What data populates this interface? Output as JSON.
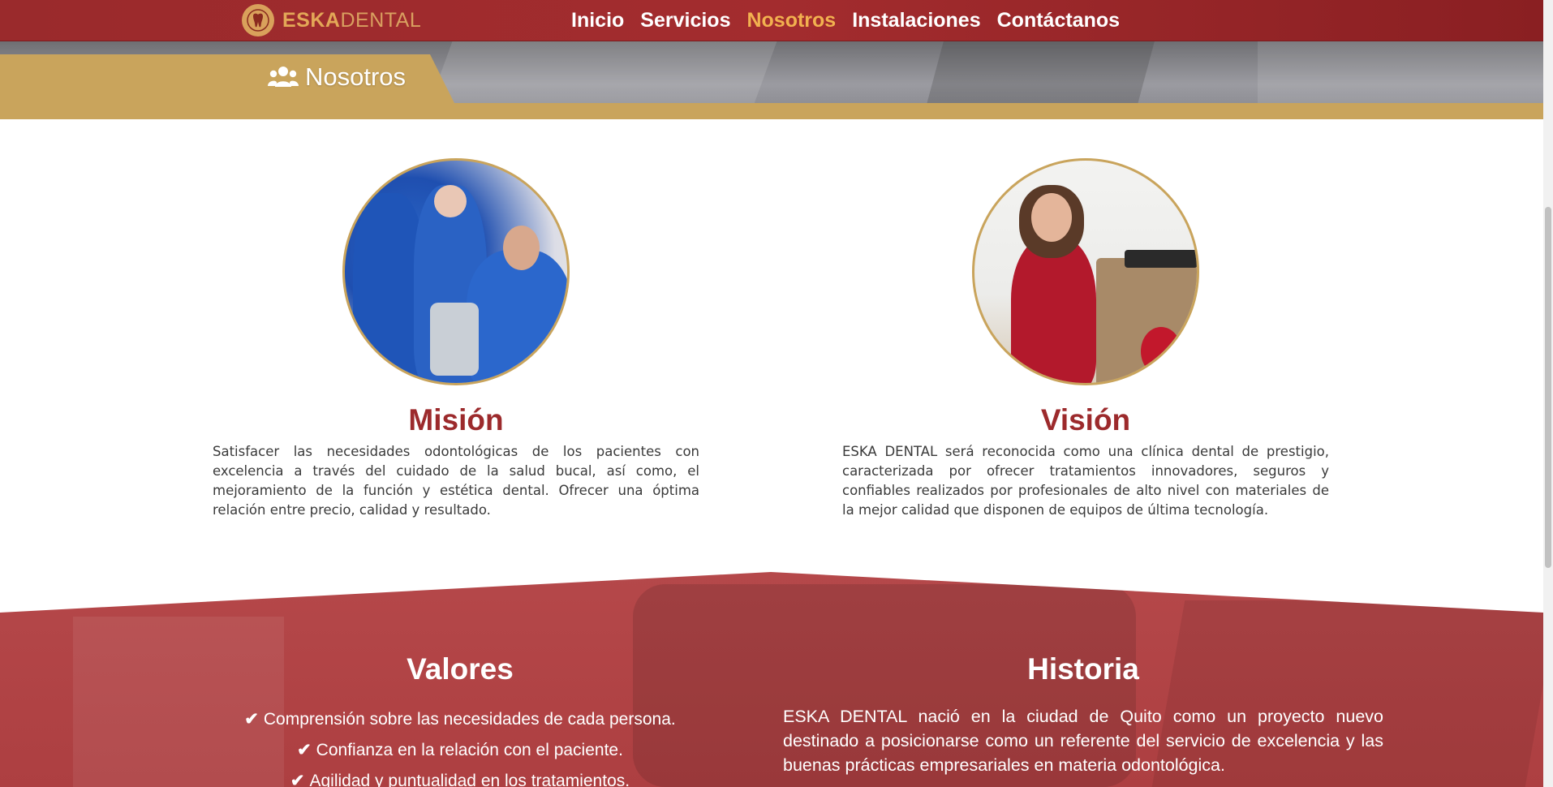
{
  "brand": {
    "name_part1": "ESKA",
    "name_part2": "DENTAL",
    "primary_color": "#a32c2e",
    "accent_color": "#c9a45c",
    "logo_icon": "tooth-icon"
  },
  "nav": {
    "items": [
      {
        "label": "Inicio",
        "active": false
      },
      {
        "label": "Servicios",
        "active": false
      },
      {
        "label": "Nosotros",
        "active": true
      },
      {
        "label": "Instalaciones",
        "active": false
      },
      {
        "label": "Contáctanos",
        "active": false
      }
    ]
  },
  "hero": {
    "title": "Nosotros",
    "icon": "users-icon"
  },
  "mision": {
    "title": "Misión",
    "text": "Satisfacer las necesidades odontológicas de los pacientes con excelencia a través del cuidado de la salud bucal, así como, el mejoramiento de la función y estética dental. Ofrecer una óptima relación entre precio, calidad y resultado."
  },
  "vision": {
    "title": "Visión",
    "text": "ESKA DENTAL será reconocida como una clínica dental de prestigio, caracterizada por ofrecer tratamientos innovadores, seguros y confiables realizados por profesionales de alto nivel con materiales de la mejor calidad que disponen de equipos de última tecnología."
  },
  "valores": {
    "title": "Valores",
    "items": [
      "Comprensión sobre las necesidades de cada persona.",
      "Confianza en la relación con el paciente.",
      "Agilidad y puntualidad en los tratamientos."
    ],
    "check_icon": "check-icon"
  },
  "historia": {
    "title": "Historia",
    "text": "ESKA DENTAL nació en la ciudad de Quito como un proyecto nuevo destinado a posicionarse como un referente del servicio de excelencia y las buenas prácticas empresariales en materia odontológica."
  }
}
